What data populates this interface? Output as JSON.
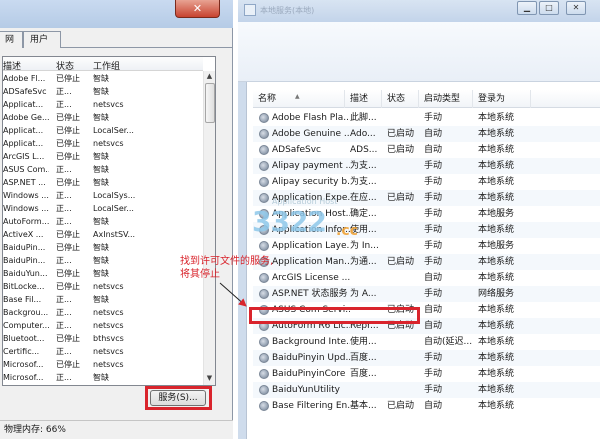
{
  "task_manager": {
    "tabs": [
      "网",
      "用户"
    ],
    "columns": [
      "描述",
      "状态",
      "工作组"
    ],
    "rows": [
      [
        "Adobe Fl...",
        "已停止",
        "智缺"
      ],
      [
        "ADSafeSvc",
        "正...",
        "智缺"
      ],
      [
        "Applicat...",
        "正...",
        "netsvcs"
      ],
      [
        "Adobe Ge...",
        "已停止",
        "智缺"
      ],
      [
        "Applicat...",
        "已停止",
        "LocalSer..."
      ],
      [
        "Applicat...",
        "已停止",
        "netsvcs"
      ],
      [
        "ArcGIS L...",
        "已停止",
        "智缺"
      ],
      [
        "ASUS Com...",
        "正...",
        "智缺"
      ],
      [
        "ASP.NET ...",
        "已停止",
        "智缺"
      ],
      [
        "Windows ...",
        "正...",
        "LocalSys..."
      ],
      [
        "Windows ...",
        "正...",
        "LocalSer..."
      ],
      [
        "AutoForm...",
        "正...",
        "智缺"
      ],
      [
        "ActiveX ...",
        "已停止",
        "AxInstSV..."
      ],
      [
        "BaiduPin...",
        "已停止",
        "智缺"
      ],
      [
        "BaiduPin...",
        "正...",
        "智缺"
      ],
      [
        "BaiduYun...",
        "已停止",
        "智缺"
      ],
      [
        "BitLocke...",
        "已停止",
        "netsvcs"
      ],
      [
        "Base Fil...",
        "正...",
        "智缺"
      ],
      [
        "Backgrou...",
        "正...",
        "netsvcs"
      ],
      [
        "Computer...",
        "正...",
        "netsvcs"
      ],
      [
        "Bluetoot...",
        "已停止",
        "bthsvcs"
      ],
      [
        "Certific...",
        "正...",
        "netsvcs"
      ],
      [
        "Microsof...",
        "已停止",
        "netsvcs"
      ],
      [
        "Microsof...",
        "正...",
        "智缺"
      ]
    ],
    "services_button": "服务(S)...",
    "status_bar": "物理内存: 66%"
  },
  "services_window": {
    "title": "本地服务(本地)",
    "columns": [
      "名称",
      "描述",
      "状态",
      "启动类型",
      "登录为"
    ],
    "rows": [
      [
        "Adobe Flash Pla...",
        "此脚...",
        "",
        "手动",
        "本地系统"
      ],
      [
        "Adobe Genuine ...",
        "Ado...",
        "已启动",
        "自动",
        "本地系统"
      ],
      [
        "ADSafeSvc",
        "ADS...",
        "已启动",
        "自动",
        "本地系统"
      ],
      [
        "Alipay payment ...",
        "为支...",
        "",
        "手动",
        "本地系统"
      ],
      [
        "Alipay security b...",
        "为支...",
        "",
        "手动",
        "本地系统"
      ],
      [
        "Application Expe...",
        "在应...",
        "已启动",
        "手动",
        "本地系统"
      ],
      [
        "Application Host...",
        "确定...",
        "",
        "手动",
        "本地服务"
      ],
      [
        "Application Infor...",
        "使用...",
        "",
        "手动",
        "本地系统"
      ],
      [
        "Application Laye...",
        "为 In...",
        "",
        "手动",
        "本地服务"
      ],
      [
        "Application Man...",
        "为通...",
        "已启动",
        "手动",
        "本地系统"
      ],
      [
        "ArcGIS License ...",
        "",
        "",
        "自动",
        "本地系统"
      ],
      [
        "ASP.NET 状态服务",
        "为 A...",
        "",
        "手动",
        "网络服务"
      ],
      [
        "ASUS Com Servi...",
        "",
        "已启动",
        "自动",
        "本地系统"
      ],
      [
        "AutoForm R6 Lic...",
        "Repr...",
        "已启动",
        "自动",
        "本地系统"
      ],
      [
        "Background Inte...",
        "使用...",
        "",
        "自动(延迟...",
        "本地系统"
      ],
      [
        "BaiduPinyin Upd...",
        "百度...",
        "",
        "手动",
        "本地系统"
      ],
      [
        "BaiduPinyinCore",
        "百度...",
        "",
        "手动",
        "本地系统"
      ],
      [
        "BaiduYunUtility",
        "",
        "",
        "手动",
        "本地系统"
      ],
      [
        "Base Filtering En...",
        "基本...",
        "已启动",
        "自动",
        "本地系统"
      ]
    ]
  },
  "annotation": {
    "line1": "找到许可文件的服务,",
    "line2": "将其停止",
    "color": "#d9242c"
  },
  "watermark": {
    "digits": "3322",
    "suffix": ".cc",
    "top_text": "Application Host"
  }
}
